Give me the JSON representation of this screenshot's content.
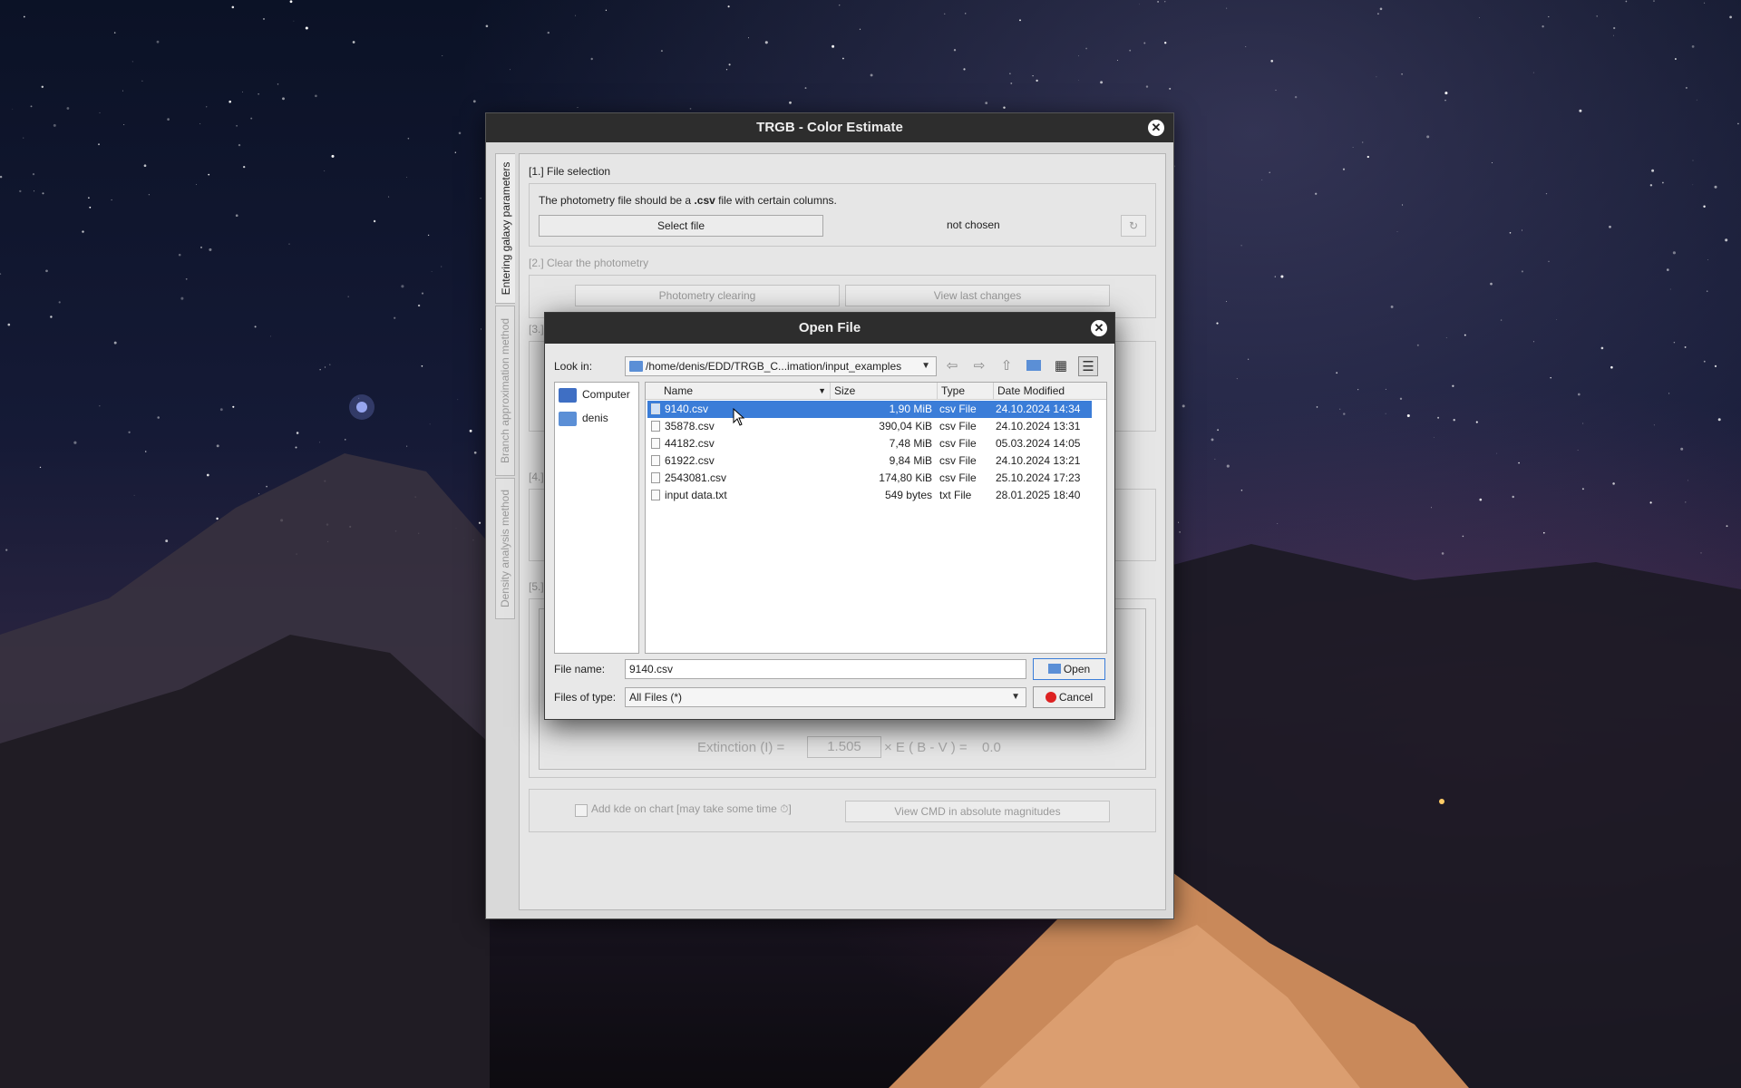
{
  "main_window": {
    "title": "TRGB - Color Estimate",
    "tabs": [
      "Entering galaxy parameters",
      "Branch approximation method",
      "Density analysis method"
    ],
    "section1": {
      "label": "[1.] File selection",
      "description_prefix": "The photometry file should be a ",
      "description_bold": ".csv",
      "description_suffix": " file with certain columns.",
      "select_button": "Select file",
      "status": "not chosen",
      "refresh_icon": "refresh-icon"
    },
    "section2": {
      "label": "[2.] Clear the photometry",
      "clearing_button": "Photometry clearing",
      "view_changes_button": "View last changes"
    },
    "section3_label": "[3.]",
    "section4_label": "[4.]",
    "section5_label": "[5.]",
    "extinction": {
      "label": "Extinction (I) =",
      "value": "1.505",
      "formula": "× E ( B - V ) =",
      "result": "0.0"
    },
    "kde_checkbox": "Add kde on chart [may take some time ⏱]",
    "view_cmd_button": "View CMD in absolute magnitudes"
  },
  "dialog": {
    "title": "Open File",
    "look_in_label": "Look in:",
    "look_in_path": "/home/denis/EDD/TRGB_C...imation/input_examples",
    "sidebar": [
      {
        "label": "Computer",
        "icon": "computer-icon"
      },
      {
        "label": "denis",
        "icon": "folder-icon"
      }
    ],
    "columns": [
      "Name",
      "Size",
      "Type",
      "Date Modified"
    ],
    "files": [
      {
        "name": "9140.csv",
        "size": "1,90 MiB",
        "type": "csv File",
        "date": "24.10.2024 14:34"
      },
      {
        "name": "35878.csv",
        "size": "390,04 KiB",
        "type": "csv File",
        "date": "24.10.2024 13:31"
      },
      {
        "name": "44182.csv",
        "size": "7,48 MiB",
        "type": "csv File",
        "date": "05.03.2024 14:05"
      },
      {
        "name": "61922.csv",
        "size": "9,84 MiB",
        "type": "csv File",
        "date": "24.10.2024 13:21"
      },
      {
        "name": "2543081.csv",
        "size": "174,80 KiB",
        "type": "csv File",
        "date": "25.10.2024 17:23"
      },
      {
        "name": "input data.txt",
        "size": "549 bytes",
        "type": "txt File",
        "date": "28.01.2025 18:40"
      }
    ],
    "selected_index": 0,
    "file_name_label": "File name:",
    "file_name_value": "9140.csv",
    "files_of_type_label": "Files of type:",
    "files_of_type_value": "All Files (*)",
    "open_button": "Open",
    "cancel_button": "Cancel"
  },
  "colors": {
    "selection": "#3b7dd8",
    "titlebar": "#2d2d2d"
  }
}
